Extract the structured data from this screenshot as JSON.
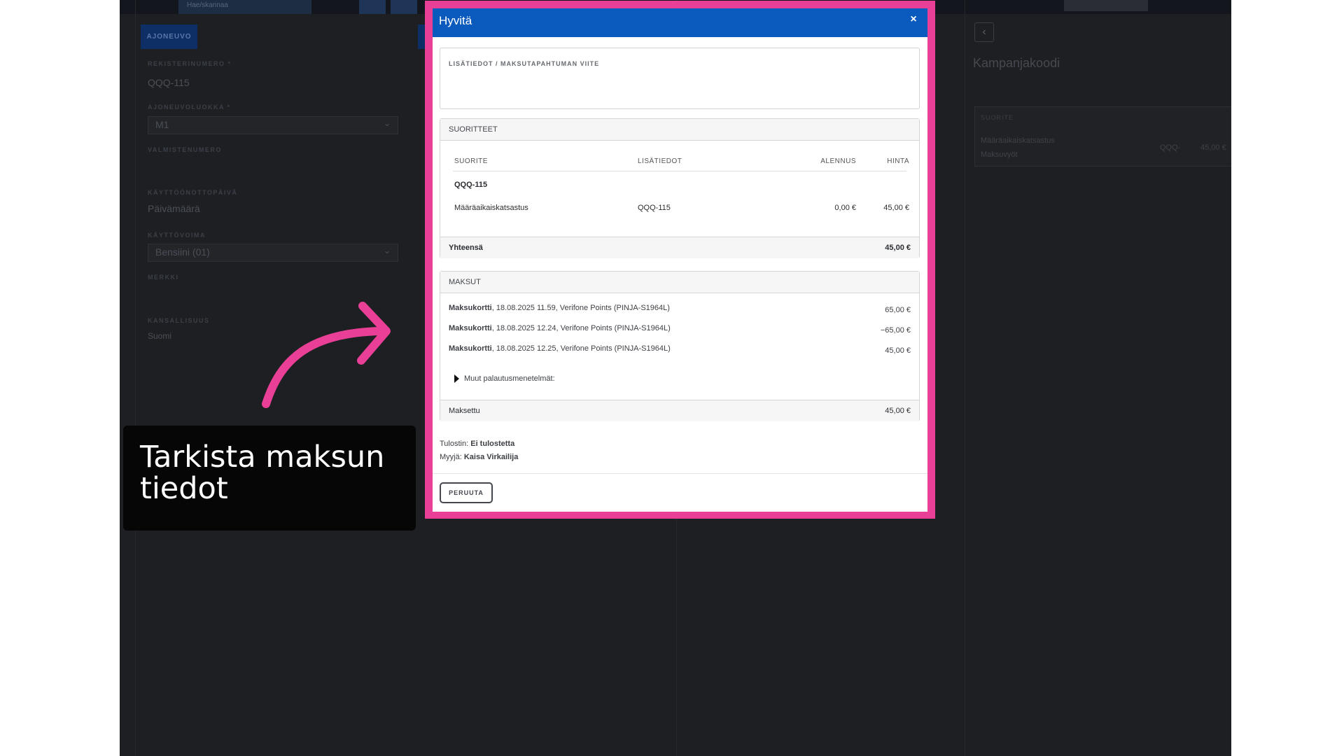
{
  "background_app": {
    "search_placeholder": "Hae/skannaa",
    "vehicle_tab_label": "AJONEUVO",
    "fields": [
      {
        "label": "REKISTERINUMERO *",
        "value": "QQQ-115"
      },
      {
        "label": "AJONEUVOLUOKKA *",
        "value": "M1"
      },
      {
        "label": "VALMISTENUMERO",
        "value": ""
      },
      {
        "label": "KÄYTTÖÖNOTTOPÄIVÄ",
        "value": "Päivämäärä"
      },
      {
        "label": "KÄYTTÖVOIMA",
        "value": "Bensiini (01)"
      },
      {
        "label": "MERKKI",
        "value": ""
      },
      {
        "label": "KANSALLISUUS",
        "value": "Suomi"
      }
    ],
    "right_panel": {
      "title": "Kampanjakoodi",
      "table_header": "SUORITE",
      "row_name": "Määräaikaiskatsastus",
      "row_sub": "Maksuvyöt",
      "row_plate": "QQQ-",
      "row_price": "45,00 €"
    }
  },
  "modal": {
    "title": "Hyvitä",
    "close_label": "×",
    "textarea_label": "LISÄTIEDOT / MAKSUTAPAHTUMAN VIITE",
    "services": {
      "heading": "SUORITTEET",
      "columns": [
        "SUORITE",
        "LISÄTIEDOT",
        "ALENNUS",
        "HINTA"
      ],
      "group_label": "QQQ-115",
      "rows": [
        {
          "service": "Määräaikaiskatsastus",
          "info": "QQQ-115",
          "discount": "0,00 €",
          "price": "45,00 €"
        }
      ],
      "total_label": "Yhteensä",
      "total_value": "45,00 €"
    },
    "payments": {
      "heading": "MAKSUT",
      "rows": [
        {
          "method": "Maksukortti",
          "detail": ", 18.08.2025 11.59, Verifone Points (PINJA-S1964L)",
          "amount": "65,00 €"
        },
        {
          "method": "Maksukortti",
          "detail": ", 18.08.2025 12.24, Verifone Points (PINJA-S1964L)",
          "amount": "−65,00 €"
        },
        {
          "method": "Maksukortti",
          "detail": ", 18.08.2025 12.25, Verifone Points (PINJA-S1964L)",
          "amount": "45,00 €"
        }
      ],
      "other_methods_label": "Muut palautusmenetelmät:",
      "paid_label": "Maksettu",
      "paid_value": "45,00 €"
    },
    "printer_label": "Tulostin: ",
    "printer_value": "Ei tulostetta",
    "seller_label": "Myyjä: ",
    "seller_value": "Kaisa Virkailija",
    "cancel_label": "PERUUTA"
  },
  "callout": {
    "text": "Tarkista maksun tiedot"
  },
  "colors": {
    "highlight": "#ea3f96",
    "modal_header": "#0a5bbd",
    "backdrop": "#1e1f22",
    "callout_bg": "#060606"
  }
}
